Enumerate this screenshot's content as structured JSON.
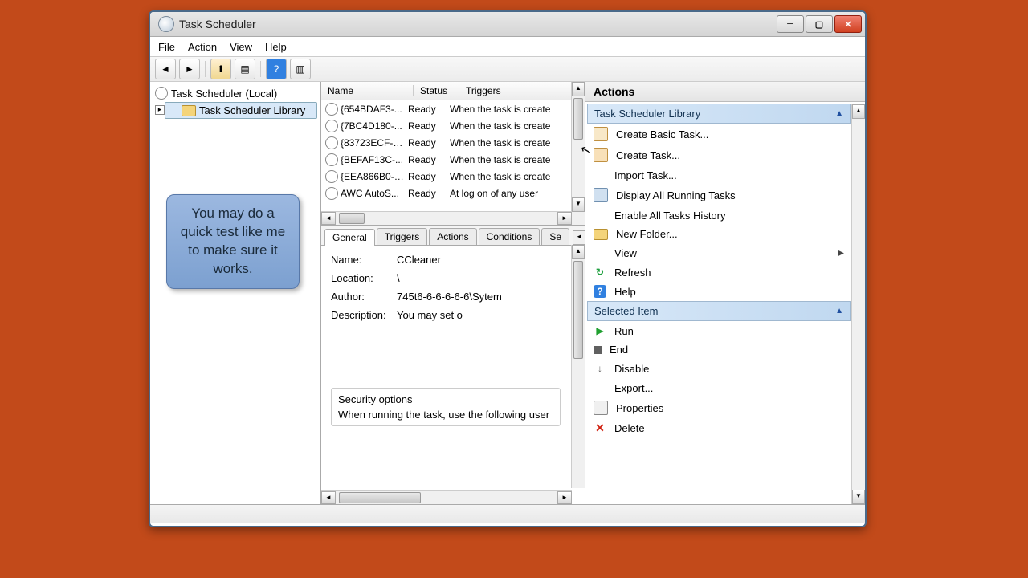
{
  "window": {
    "title": "Task Scheduler"
  },
  "menubar": {
    "file": "File",
    "action": "Action",
    "view": "View",
    "help": "Help"
  },
  "tree": {
    "root": "Task Scheduler (Local)",
    "library": "Task Scheduler Library"
  },
  "callout": "You may do a quick test like me to make sure it works.",
  "task_list": {
    "columns": {
      "name": "Name",
      "status": "Status",
      "triggers": "Triggers"
    },
    "rows": [
      {
        "name": "{654BDAF3-...",
        "status": "Ready",
        "triggers": "When the task is create"
      },
      {
        "name": "{7BC4D180-...",
        "status": "Ready",
        "triggers": "When the task is create"
      },
      {
        "name": "{83723ECF-5...",
        "status": "Ready",
        "triggers": "When the task is create"
      },
      {
        "name": "{BEFAF13C-...",
        "status": "Ready",
        "triggers": "When the task is create"
      },
      {
        "name": "{EEA866B0-1...",
        "status": "Ready",
        "triggers": "When the task is create"
      },
      {
        "name": "AWC AutoS...",
        "status": "Ready",
        "triggers": "At log on of any user"
      }
    ]
  },
  "details": {
    "tabs": {
      "general": "General",
      "triggers": "Triggers",
      "actions": "Actions",
      "conditions": "Conditions",
      "settings": "Se"
    },
    "fields": {
      "name_label": "Name:",
      "name_value": "CCleaner",
      "location_label": "Location:",
      "location_value": "\\",
      "author_label": "Author:",
      "author_value": "745t6-6-6-6-6-6\\Sytem",
      "description_label": "Description:",
      "description_value": "You may set o"
    },
    "security": {
      "heading": "Security options",
      "line1": "When running the task, use the following user"
    }
  },
  "actions_panel": {
    "title": "Actions",
    "section_library": "Task Scheduler Library",
    "items_library": {
      "create_basic": "Create Basic Task...",
      "create_task": "Create Task...",
      "import_task": "Import Task...",
      "display_running": "Display All Running Tasks",
      "enable_history": "Enable All Tasks History",
      "new_folder": "New Folder...",
      "view": "View",
      "refresh": "Refresh",
      "help": "Help"
    },
    "section_selected": "Selected Item",
    "items_selected": {
      "run": "Run",
      "end": "End",
      "disable": "Disable",
      "export": "Export...",
      "properties": "Properties",
      "delete": "Delete"
    }
  }
}
